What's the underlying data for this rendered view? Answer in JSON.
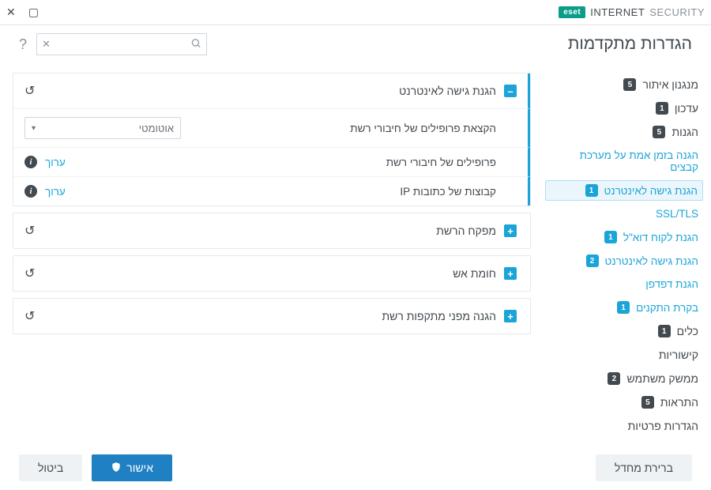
{
  "brand": {
    "logo": "eset",
    "text1": "INTERNET",
    "text2": "SECURITY"
  },
  "page_title": "הגדרות מתקדמות",
  "search": {
    "placeholder": ""
  },
  "sidebar": {
    "items": [
      {
        "label": "מנגנון איתור",
        "badge": "5",
        "kind": "top"
      },
      {
        "label": "עדכון",
        "badge": "1",
        "kind": "top"
      },
      {
        "label": "הגנות",
        "badge": "5",
        "kind": "top"
      },
      {
        "label": "הגנה בזמן אמת על מערכת קבצים",
        "badge": "",
        "kind": "sub"
      },
      {
        "label": "הגנת גישה לאינטרנט",
        "badge": "1",
        "kind": "sub",
        "active": true
      },
      {
        "label": "SSL/TLS",
        "badge": "",
        "kind": "sub"
      },
      {
        "label": "הגנת לקוח דוא\"ל",
        "badge": "1",
        "kind": "sub"
      },
      {
        "label": "הגנת גישה לאינטרנט",
        "badge": "2",
        "kind": "sub"
      },
      {
        "label": "הגנת דפדפן",
        "badge": "",
        "kind": "sub"
      },
      {
        "label": "בקרת התקנים",
        "badge": "1",
        "kind": "sub"
      },
      {
        "label": "כלים",
        "badge": "1",
        "kind": "top"
      },
      {
        "label": "קישוריות",
        "badge": "",
        "kind": "top"
      },
      {
        "label": "ממשק משתמש",
        "badge": "2",
        "kind": "top"
      },
      {
        "label": "התראות",
        "badge": "5",
        "kind": "top"
      },
      {
        "label": "הגדרות פרטיות",
        "badge": "",
        "kind": "top"
      }
    ]
  },
  "panels": [
    {
      "title": "הגנת גישה לאינטרנט",
      "expanded": true,
      "rows": [
        {
          "label": "הקצאת פרופילים של חיבורי רשת",
          "control": "select",
          "value": "אוטומטי"
        },
        {
          "label": "פרופילים של חיבורי רשת",
          "control": "link",
          "value": "ערוך"
        },
        {
          "label": "קבוצות של כתובות IP",
          "control": "link",
          "value": "ערוך"
        }
      ]
    },
    {
      "title": "מפקח הרשת",
      "expanded": false
    },
    {
      "title": "חומת אש",
      "expanded": false
    },
    {
      "title": "הגנה מפני מתקפות רשת",
      "expanded": false
    }
  ],
  "footer": {
    "default": "ברירת מחדל",
    "ok": "אישור",
    "cancel": "ביטול"
  }
}
